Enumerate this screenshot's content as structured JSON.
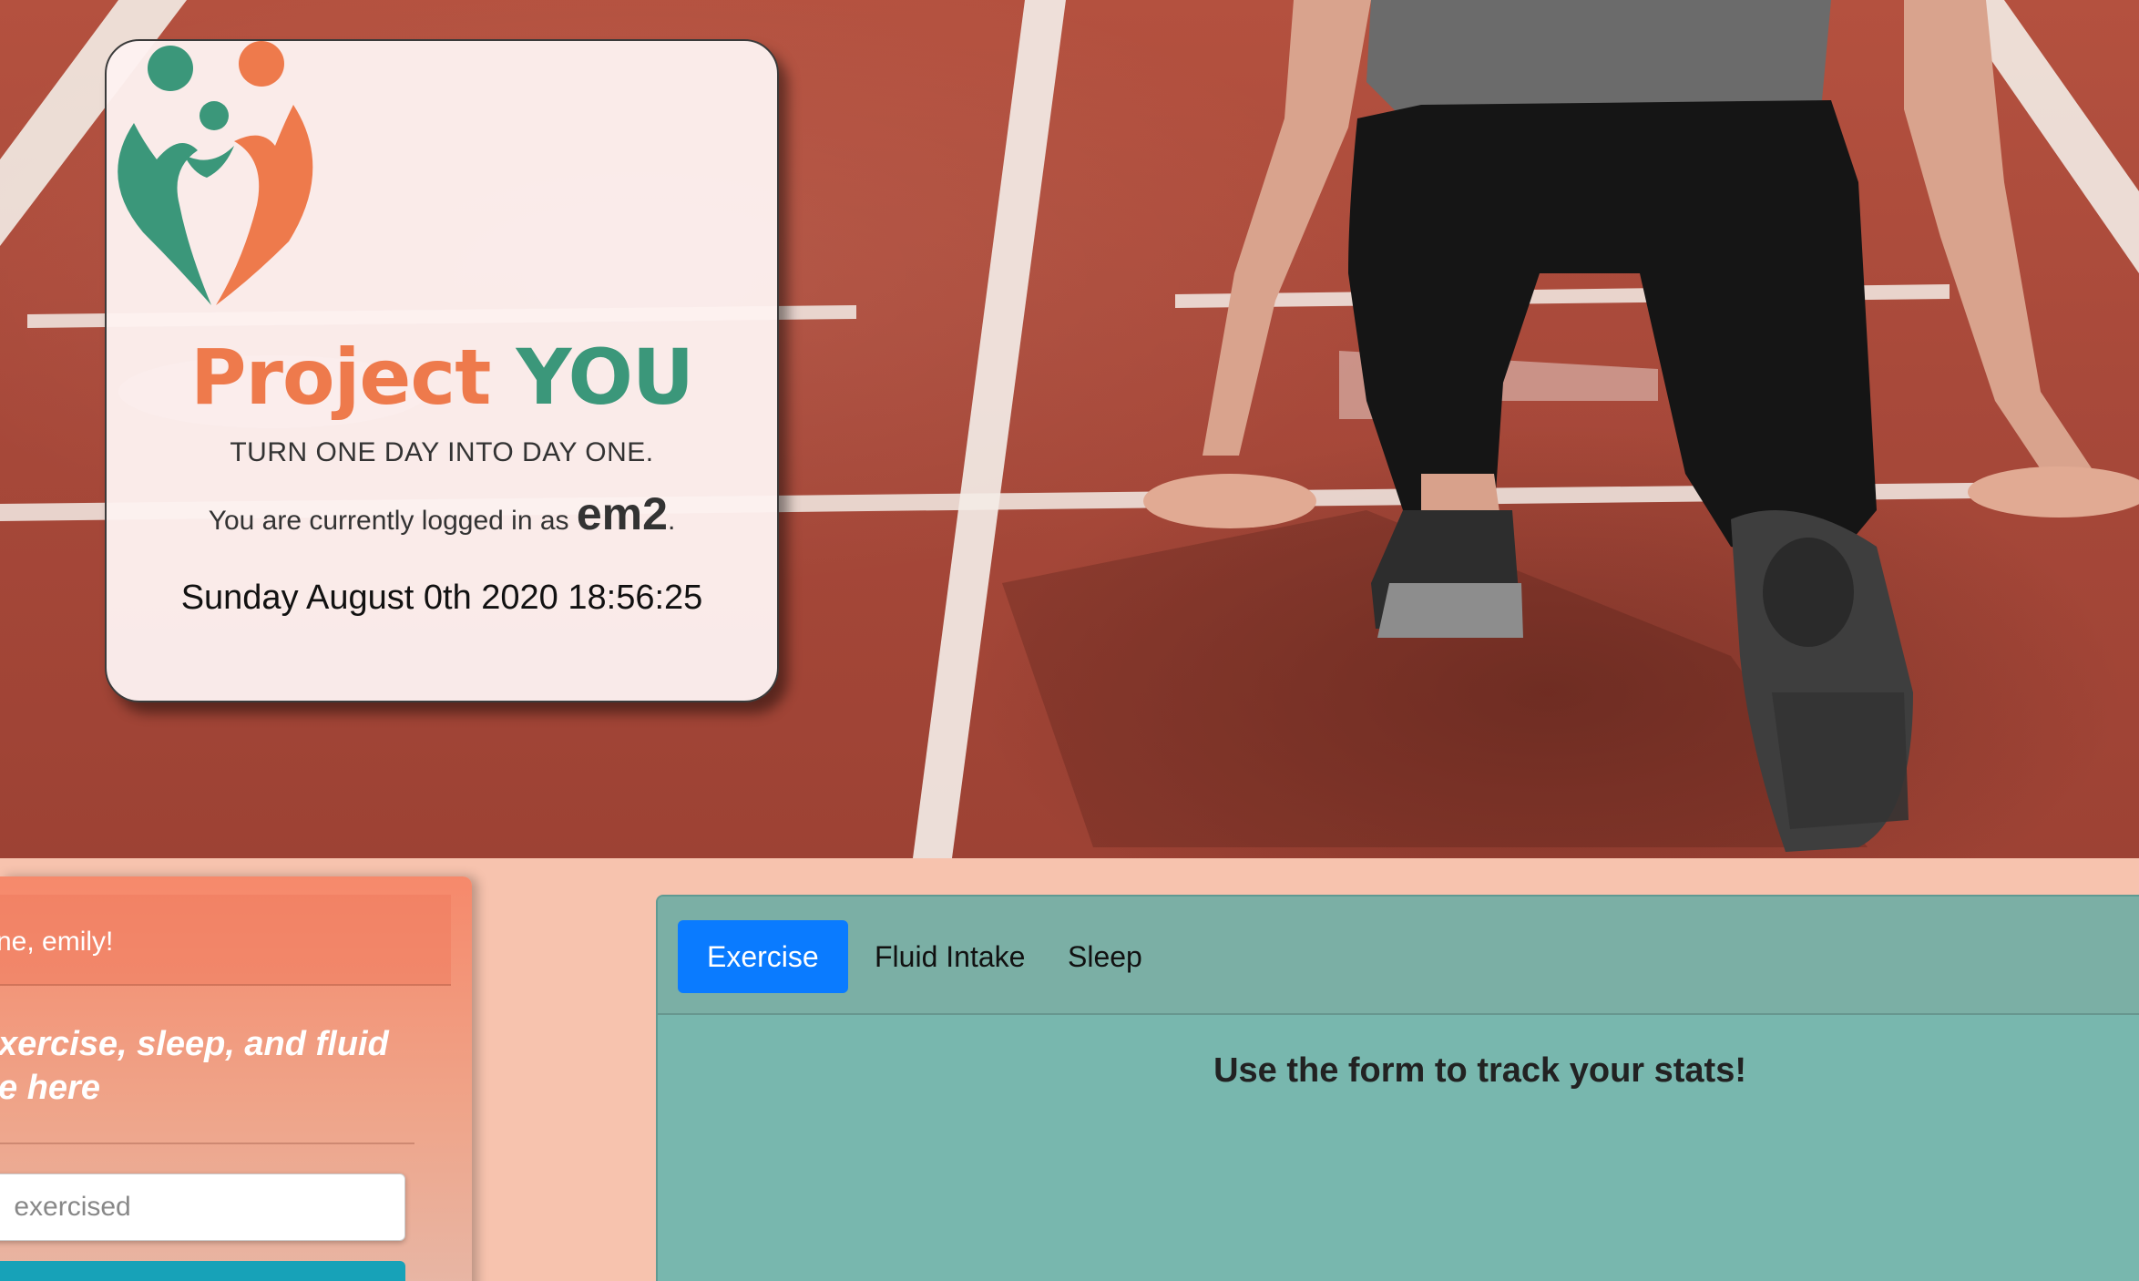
{
  "brand": {
    "word1": "Project",
    "word2": "YOU",
    "tagline": "TURN ONE DAY INTO DAY ONE.",
    "login_prefix": "You are currently logged in as ",
    "username": "em2",
    "login_suffix": ".",
    "clock": "Sunday August 0th 2020 18:56:25"
  },
  "welcome": {
    "greeting": "ne, emily!",
    "intro_line1": "xercise, sleep, and fluid",
    "intro_line2": "e here"
  },
  "form": {
    "exercise_placeholder": " exercised"
  },
  "stats": {
    "tabs": [
      {
        "label": "Exercise",
        "active": true
      },
      {
        "label": "Fluid Intake",
        "active": false
      },
      {
        "label": "Sleep",
        "active": false
      }
    ],
    "message": "Use the form to track your stats!"
  },
  "colors": {
    "brand_orange": "#ee7a4c",
    "brand_green": "#3b977a",
    "active_tab": "#0a7bff",
    "submit_button": "#17a2b8"
  }
}
